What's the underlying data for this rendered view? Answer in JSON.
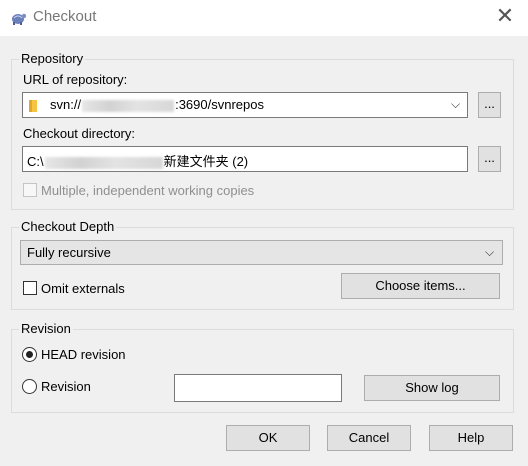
{
  "window": {
    "title": "Checkout",
    "close_glyph": "✕",
    "icon": "tortoisesvn-icon"
  },
  "repository": {
    "group_title": "Repository",
    "url_label": "URL of repository:",
    "url_prefix": "svn://",
    "url_suffix": ":3690/svnrepos",
    "browse_label": "...",
    "checkout_dir_label": "Checkout directory:",
    "dir_prefix": "C:\\",
    "dir_suffix": "新建文件夹 (2)",
    "dir_browse_label": "...",
    "multiple_label": "Multiple, independent working copies",
    "multiple_checked": false
  },
  "depth": {
    "group_title": "Checkout Depth",
    "selected": "Fully recursive",
    "omit_externals_label": "Omit externals",
    "omit_externals_checked": false,
    "choose_items_label": "Choose items..."
  },
  "revision": {
    "group_title": "Revision",
    "head_label": "HEAD revision",
    "revision_label": "Revision",
    "selected": "HEAD revision",
    "revision_value": "",
    "show_log_label": "Show log"
  },
  "buttons": {
    "ok": "OK",
    "cancel": "Cancel",
    "help": "Help"
  },
  "colors": {
    "dialog_bg": "#f0f0f0",
    "titlebar_bg": "#ffffff",
    "button_bg": "#e1e1e1",
    "folder_yellow": "#f5c542"
  }
}
